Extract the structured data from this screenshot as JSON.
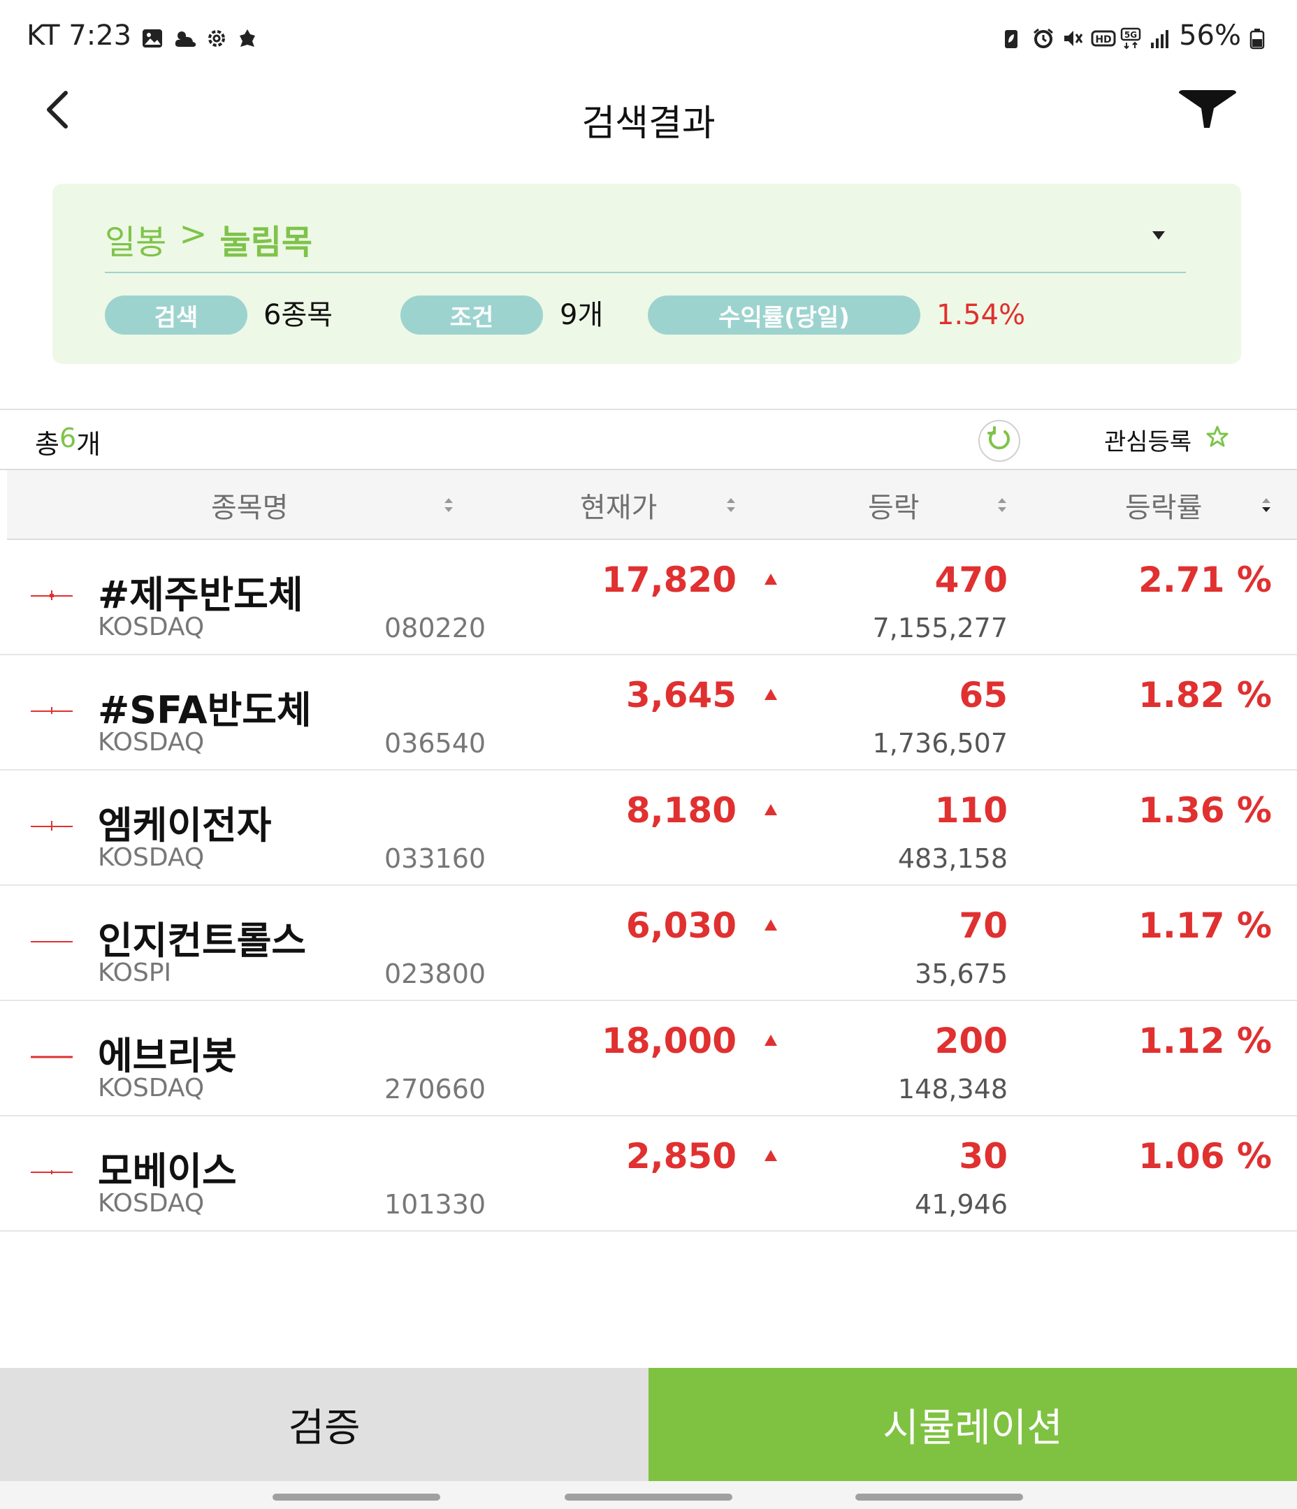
{
  "status_bar": {
    "carrier_time": "KT 7:23",
    "battery": "56%",
    "left_icons": [
      "gallery-icon",
      "weather-icon",
      "settings-gear-icon",
      "app-notification-icon"
    ],
    "right_icons": [
      "battery-saver-icon",
      "alarm-icon",
      "mute-icon",
      "hd-voice-icon",
      "5g-icon",
      "signal-icon"
    ]
  },
  "header": {
    "title": "검색결과",
    "back_icon": "chevron-left-icon",
    "filter_icon": "funnel-filter-icon"
  },
  "condition": {
    "path_prefix": "일봉",
    "separator": ">",
    "path_name": "눌림목",
    "search_label": "검색",
    "search_value": "6종목",
    "condition_label": "조건",
    "condition_value": "9개",
    "return_label": "수익률(당일)",
    "return_value": "1.54%",
    "colors": {
      "accent_green": "#7ec34a",
      "pill": "#9dd3cf",
      "panel_bg": "#eef8e6",
      "up_red": "#e03030"
    }
  },
  "list": {
    "total_prefix": "총 ",
    "total_count": "6",
    "total_suffix": "개",
    "watch_label": "관심등록",
    "refresh_icon": "refresh-icon",
    "star_icon": "star-outline-icon"
  },
  "columns": {
    "name": "종목명",
    "price": "현재가",
    "change": "등락",
    "rate": "등락률"
  },
  "rows": [
    {
      "name": "#제주반도체",
      "market": "KOSDAQ",
      "code": "080220",
      "price": "17,820",
      "change": "470",
      "volume": "7,155,277",
      "rate": "2.71 %"
    },
    {
      "name": "#SFA반도체",
      "market": "KOSDAQ",
      "code": "036540",
      "price": "3,645",
      "change": "65",
      "volume": "1,736,507",
      "rate": "1.82 %"
    },
    {
      "name": "엠케이전자",
      "market": "KOSDAQ",
      "code": "033160",
      "price": "8,180",
      "change": "110",
      "volume": "483,158",
      "rate": "1.36 %"
    },
    {
      "name": "인지컨트롤스",
      "market": "KOSPI",
      "code": "023800",
      "price": "6,030",
      "change": "70",
      "volume": "35,675",
      "rate": "1.17 %"
    },
    {
      "name": "에브리봇",
      "market": "KOSDAQ",
      "code": "270660",
      "price": "18,000",
      "change": "200",
      "volume": "148,348",
      "rate": "1.12 %"
    },
    {
      "name": "모베이스",
      "market": "KOSDAQ",
      "code": "101330",
      "price": "2,850",
      "change": "30",
      "volume": "41,946",
      "rate": "1.06 %"
    }
  ],
  "buttons": {
    "verify": "검증",
    "simulate": "시뮬레이션"
  }
}
